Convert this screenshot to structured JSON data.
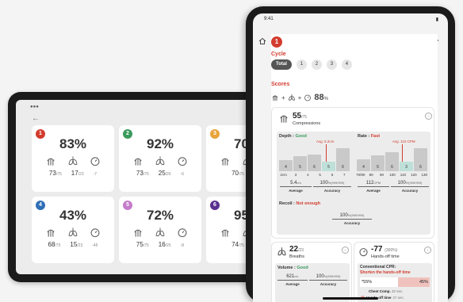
{
  "landscape": {
    "status": "●●●",
    "back_icon": "back-arrow-icon",
    "cards": [
      {
        "badge": "1",
        "color": "#d23c2e",
        "percent": "83%",
        "comp": "73",
        "comp_of": "/75",
        "breath": "17",
        "breath_of": "/23",
        "time": "-7"
      },
      {
        "badge": "2",
        "color": "#3a9a5c",
        "percent": "92%",
        "comp": "73",
        "comp_of": "/75",
        "breath": "25",
        "breath_of": "/26",
        "time": "-6"
      },
      {
        "badge": "3",
        "color": "#e8a43c",
        "percent": "70%",
        "comp": "70",
        "comp_of": "/75",
        "breath": "",
        "breath_of": "",
        "time": ""
      },
      {
        "badge": "4",
        "color": "#2f6fb7",
        "percent": "43%",
        "comp": "68",
        "comp_of": "/75",
        "breath": "15",
        "breath_of": "/23",
        "time": "-45"
      },
      {
        "badge": "5",
        "color": "#c47bc9",
        "percent": "72%",
        "comp": "75",
        "comp_of": "/75",
        "breath": "16",
        "breath_of": "/25",
        "time": "-8"
      },
      {
        "badge": "6",
        "color": "#5a2f8f",
        "percent": "95%",
        "comp": "74",
        "comp_of": "/75",
        "breath": "",
        "breath_of": "",
        "time": ""
      }
    ]
  },
  "portrait": {
    "status_time": "9:41",
    "status_right": "▮",
    "badge": "1",
    "cycle_heading": "Cycle",
    "chips": [
      "Total",
      "1",
      "2",
      "3",
      "4"
    ],
    "scores_heading": "Scores",
    "score_plus1": "+",
    "score_plus2": "+",
    "score_value": "88",
    "score_unit": "%",
    "compressions": {
      "value": "55",
      "of": "/75",
      "label": "Compressions",
      "depth_label": "Depth :",
      "depth_status": "Good",
      "rate_label": "Rate :",
      "rate_status": "Fast",
      "depth_ref": "Avg. 5.2cm",
      "rate_ref": "Avg. 110 CPM",
      "depth_bars": [
        {
          "label": "4",
          "value": 40
        },
        {
          "label": "5",
          "value": 55
        },
        {
          "label": "6",
          "value": 62
        },
        {
          "label": "5",
          "value": 35
        },
        {
          "label": "6",
          "value": 85
        }
      ],
      "depth_axis": [
        "2cm",
        "3",
        "4",
        "5",
        "6",
        "7"
      ],
      "rate_bars": [
        {
          "label": "4",
          "value": 45
        },
        {
          "label": "5",
          "value": 60
        },
        {
          "label": "6",
          "value": 70
        },
        {
          "label": "3",
          "value": 35
        },
        {
          "label": "6",
          "value": 85
        }
      ],
      "rate_axis": [
        "70/90",
        "80",
        "90",
        "100",
        "110",
        "120",
        "130"
      ],
      "depth_avg": "5.4",
      "depth_avg_unit": "cm",
      "depth_avg_label": "Average",
      "depth_acc": "100",
      "depth_acc_unit": "%(999/999)",
      "depth_acc_label": "Accuracy",
      "rate_avg": "112",
      "rate_avg_unit": "CPM",
      "rate_avg_label": "Average",
      "rate_acc": "100",
      "rate_acc_unit": "%(999/999)",
      "rate_acc_label": "Accuracy",
      "recoil_label": "Recoil :",
      "recoil_status": "Not enough",
      "recoil_acc": "100",
      "recoil_acc_unit": "%(999/999)",
      "recoil_acc_label": "Accuracy"
    },
    "breaths": {
      "value": "22",
      "of": "/23",
      "label": "Breaths",
      "volume_label": "Volume :",
      "volume_status": "Good",
      "avg": "621",
      "avg_unit": "mL",
      "avg_label": "Average",
      "acc": "100",
      "acc_unit": "%(999/999)",
      "acc_label": "Accuracy"
    },
    "handsoff": {
      "value": "-77",
      "pct": "(300%)",
      "label": "Hands-off time",
      "conv_label": "Conventional CPR:",
      "conv_msg": "Shorten the hands-off time",
      "left_val": "*55%",
      "right_val": "45%",
      "chest_label": "Chest Comp.",
      "chest_val": "32 sec.",
      "hands_label": "Hands-off time",
      "hands_val": "27 sec."
    }
  }
}
